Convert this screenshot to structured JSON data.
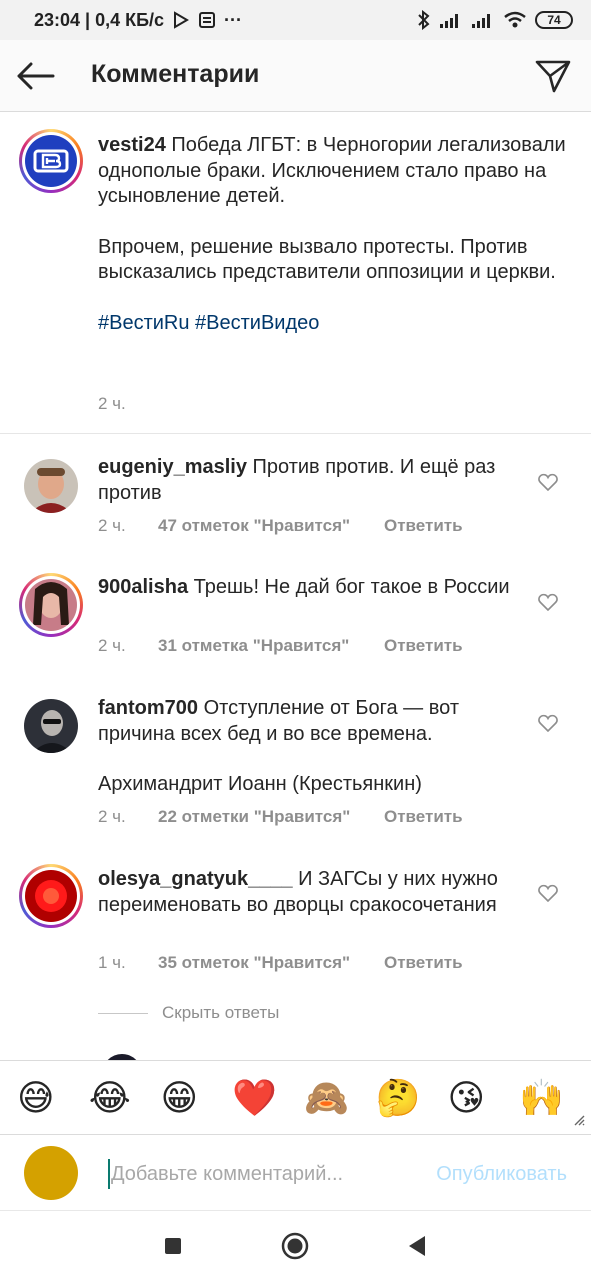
{
  "status_bar": {
    "time_speed": "23:04 | 0,4 КБ/с",
    "more": "···",
    "battery": "74"
  },
  "header": {
    "title": "Комментарии"
  },
  "post": {
    "username": "vesti24",
    "paragraphs": [
      "Победа ЛГБТ: в Черногории легализовали однополые браки. Исключением стало право на усыновление детей.",
      "Впрочем, решение вызвало протесты. Против высказались представители оппозиции и церкви."
    ],
    "hashtag1": "#ВестиRu",
    "hashtag2": "#ВестиВидео",
    "time": "2 ч."
  },
  "comments": [
    {
      "username": "eugeniy_masliy",
      "text": "Против  против. И ещё раз против",
      "time": "2 ч.",
      "likes": "47 отметок \"Нравится\"",
      "reply": "Ответить"
    },
    {
      "username": "900alisha",
      "text": "Трешь! Не дай бог такое в России",
      "time": "2 ч.",
      "likes": "31 отметка \"Нравится\"",
      "reply": "Ответить"
    },
    {
      "username": "fantom700",
      "text": "Отступление от Бога — вот причина всех бед и во все времена.",
      "text2": "Архимандрит Иоанн (Крестьянкин)",
      "time": "2 ч.",
      "likes": "22 отметки \"Нравится\"",
      "reply": "Ответить"
    },
    {
      "username": "olesya_gnatyuk____",
      "text": "И ЗАГСы  у них нужно переименовать во дворцы сракосочетания",
      "time": "1 ч.",
      "likes": "35 отметок \"Нравится\"",
      "reply": "Ответить"
    }
  ],
  "hide_replies": "Скрыть ответы",
  "emojis": [
    "😅",
    "😂",
    "😁",
    "❤️",
    "🙈",
    "🤔",
    "😘",
    "🙌"
  ],
  "input": {
    "placeholder": "Добавьте комментарий...",
    "publish": "Опубликовать"
  },
  "colors": {
    "accent_blue": "#b2dffc",
    "hashtag": "#00376b",
    "meta_gray": "#8e8e8e"
  }
}
